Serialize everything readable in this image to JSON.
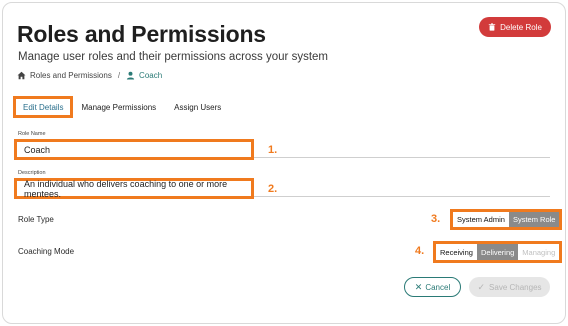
{
  "header": {
    "title": "Roles and Permissions",
    "subtitle": "Manage user roles and their permissions across your system",
    "delete_label": "Delete Role"
  },
  "breadcrumb": {
    "root": "Roles and Permissions",
    "separator": "/",
    "current": "Coach"
  },
  "tabs": [
    {
      "label": "Edit Details",
      "active": true
    },
    {
      "label": "Manage Permissions",
      "active": false
    },
    {
      "label": "Assign Users",
      "active": false
    }
  ],
  "form": {
    "role_name": {
      "label": "Role Name",
      "value": "Coach",
      "marker": "1."
    },
    "description": {
      "label": "Description",
      "value": "An individual who delivers coaching to one or more mentees.",
      "marker": "2."
    },
    "role_type": {
      "label": "Role Type",
      "marker": "3.",
      "options": [
        "System Admin",
        "System Role"
      ],
      "selected": "System Role"
    },
    "coaching_mode": {
      "label": "Coaching Mode",
      "marker": "4.",
      "options": [
        "Receiving",
        "Delivering",
        "Managing"
      ],
      "selected": "Delivering",
      "disabled": "Managing"
    }
  },
  "actions": {
    "cancel_label": "Cancel",
    "save_label": "Save Changes"
  },
  "colors": {
    "accent": "#2a7a76",
    "danger": "#d23b3b",
    "highlight": "#f07a1e"
  }
}
